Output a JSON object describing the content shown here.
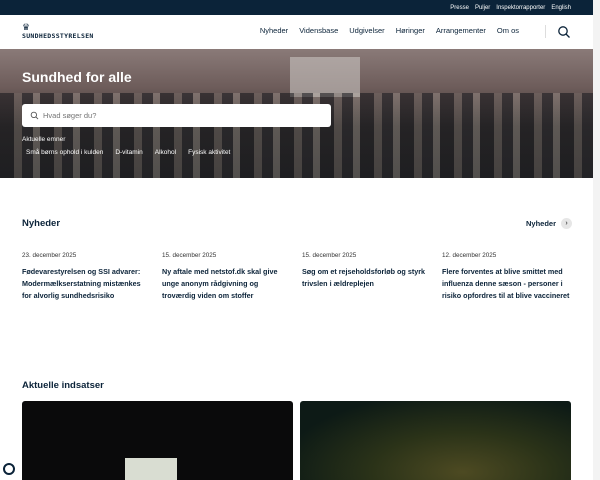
{
  "topbar": {
    "links": [
      "Presse",
      "Puljer",
      "Inspektorrapporter",
      "English"
    ]
  },
  "header": {
    "logo_text": "SUNDHEDSSTYRELSEN",
    "nav": [
      "Nyheder",
      "Vidensbase",
      "Udgivelser",
      "Høringer",
      "Arrangementer",
      "Om os"
    ]
  },
  "hero": {
    "title": "Sundhed for alle",
    "search_placeholder": "Hvad søger du?",
    "topics_label": "Aktuelle emner",
    "topics": [
      "Små børns ophold i kulden",
      "D-vitamin",
      "Alkohol",
      "Fysisk aktivitet"
    ]
  },
  "news": {
    "heading": "Nyheder",
    "more_label": "Nyheder",
    "items": [
      {
        "date": "23. december 2025",
        "title": "Fødevarestyrelsen og SSI advarer: Modermælkserstatning mistænkes for alvorlig sundhedsrisiko"
      },
      {
        "date": "15. december 2025",
        "title": "Ny aftale med netstof.dk skal give unge anonym rådgivning og troværdig viden om stoffer"
      },
      {
        "date": "15. december 2025",
        "title": "Søg om et rejseholdsforløb og styrk trivslen i ældreplejen"
      },
      {
        "date": "12. december 2025",
        "title": "Flere forventes at blive smittet med influenza denne sæson - personer i risiko opfordres til at blive vaccineret"
      }
    ]
  },
  "initiatives": {
    "heading": "Aktuelle indsatser"
  }
}
